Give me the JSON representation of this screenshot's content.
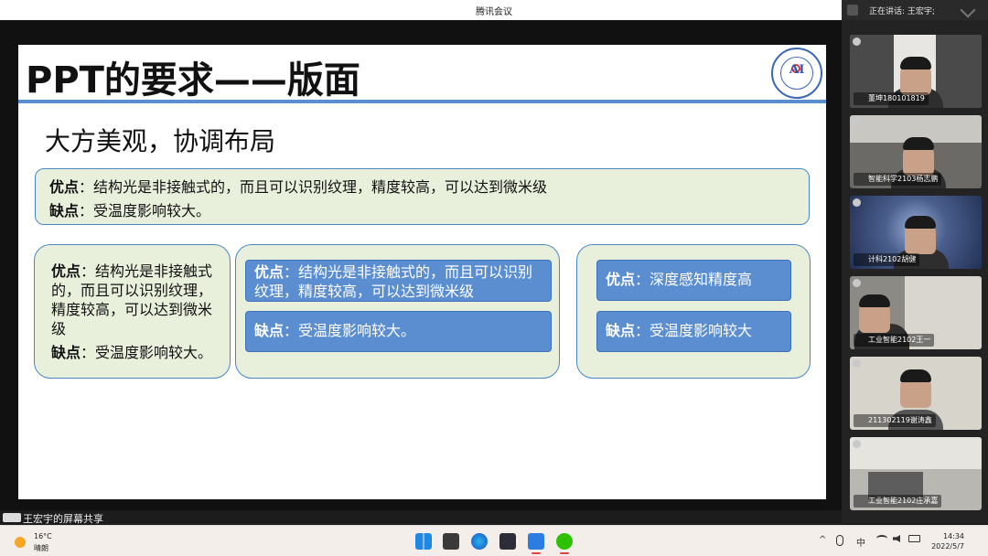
{
  "window": {
    "title": "腾讯会议"
  },
  "speaking": {
    "label": "正在讲话: 王宏宇;"
  },
  "slide": {
    "title": "PPT的要求——版面",
    "subtitle": "大方美观，协调布局",
    "wide_box": {
      "line1_key": "优点",
      "line1_text": "：结构光是非接触式的，而且可以识别纹理，精度较高，可以达到微米级",
      "line2_key": "缺点",
      "line2_text": "：受温度影响较大。"
    },
    "card1": {
      "pro_key": "优点",
      "pro_text": "：结构光是非接触式的，而且可以识别纹理，精度较高，可以达到微米级",
      "con_key": "缺点",
      "con_text": "：受温度影响较大。"
    },
    "card2": {
      "pro_key": "优点",
      "pro_text": "：结构光是非接触式的，而且可以识别纹理，精度较高，可以达到微米级",
      "con_key": "缺点",
      "con_text": "：受温度影响较大。"
    },
    "card3": {
      "pro_key": "优点",
      "pro_text": "：深度感知精度高",
      "con_key": "缺点",
      "con_text": "：受温度影响较大"
    }
  },
  "participants": [
    {
      "name": "董坤180101819"
    },
    {
      "name": "智能科学2103杨志鹏"
    },
    {
      "name": "计科2102胡健"
    },
    {
      "name": "工业智能2102王一"
    },
    {
      "name": "211302119谢涛鑫"
    },
    {
      "name": "工业智能2102庄承嘉"
    }
  ],
  "share": {
    "label": "王宏宇的屏幕共享"
  },
  "taskbar": {
    "weather_temp": "16°C",
    "weather_desc": "晴朗",
    "ime": "中",
    "time": "14:34",
    "date": "2022/5/7"
  },
  "colors": {
    "accent_blue": "#5b8ed0",
    "box_green": "#e8f0dc"
  }
}
